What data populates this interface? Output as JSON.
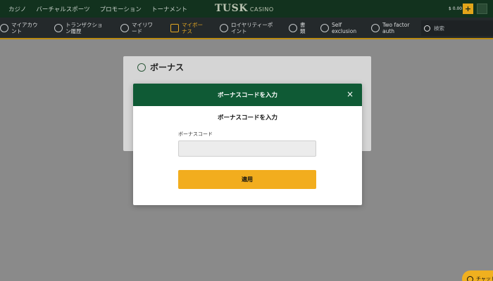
{
  "topnav": [
    "カジノ",
    "バーチャルスポーツ",
    "プロモーション",
    "トーナメント"
  ],
  "brand": {
    "main": "TUSK",
    "sub": "CASINO"
  },
  "balance": "$ 0.00",
  "plus_label": "+",
  "subnav": [
    {
      "label": "マイアカウ\nント",
      "icon": "user-icon"
    },
    {
      "label": "トランザクショ\nン履歴",
      "icon": "history-icon"
    },
    {
      "label": "マイリワ\nード",
      "icon": "reward-icon"
    },
    {
      "label": "マイボー\nナス",
      "icon": "gift-icon",
      "active": true
    },
    {
      "label": "ロイヤリティーポ\nイント",
      "icon": "star-icon"
    },
    {
      "label": "書\n類",
      "icon": "shield-icon"
    },
    {
      "label": "Self\nexclusion",
      "icon": "lock-icon"
    },
    {
      "label": "Two factor\nauth",
      "icon": "key-icon"
    }
  ],
  "search": {
    "placeholder": "検索"
  },
  "card": {
    "title": "ボーナス"
  },
  "modal": {
    "title": "ボーナスコードを入力",
    "close": "×",
    "subtitle": "ボーナスコードを入力",
    "field_label": "ボーナスコード",
    "field_value": "",
    "apply_label": "適用"
  },
  "chat": {
    "label": "チャット"
  },
  "colors": {
    "topbar": "#12321e",
    "subnav": "#24292b",
    "accent": "#f2ad1e",
    "modal_header": "#0f5a35",
    "overlay": "#8a8a8a"
  }
}
